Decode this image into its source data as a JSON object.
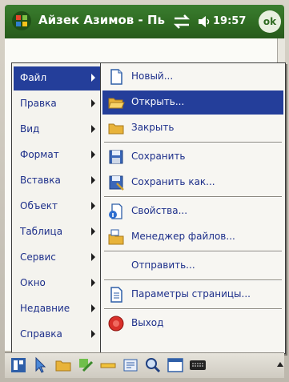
{
  "titlebar": {
    "title": "Айзек Азимов - Пь",
    "time": "19:57",
    "ok_label": "ok"
  },
  "main_menu": {
    "items": [
      {
        "label": "Файл",
        "selected": true
      },
      {
        "label": "Правка"
      },
      {
        "label": "Вид"
      },
      {
        "label": "Формат"
      },
      {
        "label": "Вставка"
      },
      {
        "label": "Объект"
      },
      {
        "label": "Таблица"
      },
      {
        "label": "Сервис"
      },
      {
        "label": "Окно"
      },
      {
        "label": "Недавние"
      },
      {
        "label": "Справка"
      }
    ]
  },
  "file_menu": {
    "items": [
      {
        "label": "Новый...",
        "icon": "new-document-icon"
      },
      {
        "label": "Открыть...",
        "icon": "open-folder-icon",
        "selected": true
      },
      {
        "label": "Закрыть",
        "icon": "close-folder-icon"
      },
      {
        "label": "Сохранить",
        "icon": "save-icon"
      },
      {
        "label": "Сохранить как...",
        "icon": "save-as-icon"
      },
      {
        "label": "Свойства...",
        "icon": "properties-icon"
      },
      {
        "label": "Менеджер файлов...",
        "icon": "file-manager-icon"
      },
      {
        "label": "Отправить..."
      },
      {
        "label": "Параметры страницы...",
        "icon": "page-setup-icon"
      },
      {
        "label": "Выход",
        "icon": "exit-icon"
      }
    ]
  },
  "colors": {
    "titlebar": "#2f6b22",
    "selection": "#243e9a",
    "menu_text": "#1d2f8a"
  }
}
